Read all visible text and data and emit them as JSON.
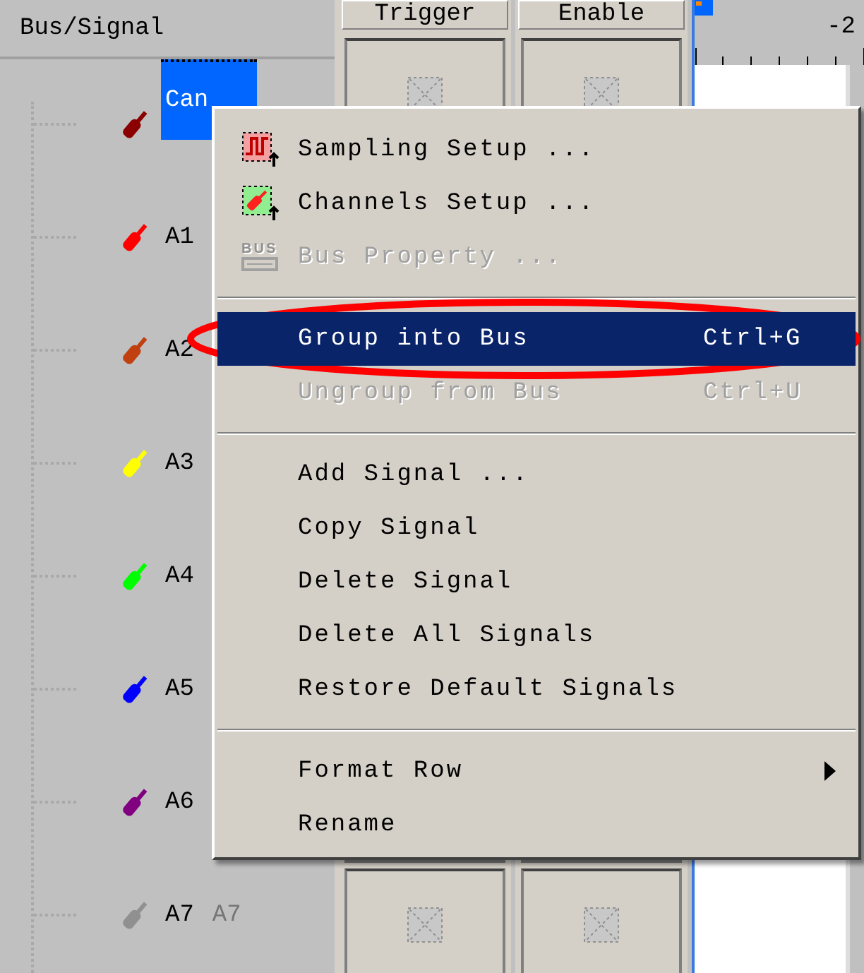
{
  "signal_panel": {
    "header": "Bus/Signal",
    "signals": [
      {
        "name": "Can",
        "color": "#8b0000",
        "selected": true
      },
      {
        "name": "A1",
        "color": "#ff0000",
        "selected": false
      },
      {
        "name": "A2",
        "color": "#c04010",
        "selected": false
      },
      {
        "name": "A3",
        "color": "#ffff00",
        "selected": false
      },
      {
        "name": "A4",
        "color": "#00ff00",
        "selected": false
      },
      {
        "name": "A5",
        "color": "#0000ff",
        "selected": false
      },
      {
        "name": "A6",
        "color": "#800080",
        "selected": false
      },
      {
        "name": "A7",
        "color": "#909090",
        "selected": false,
        "alias": "A7"
      }
    ]
  },
  "columns": [
    {
      "header": "Trigger"
    },
    {
      "header": "Enable"
    }
  ],
  "timeline": {
    "tick_label": "-2"
  },
  "context_menu": {
    "items": [
      {
        "kind": "item",
        "label": "Sampling Setup ...",
        "disabled": false,
        "selected": false
      },
      {
        "kind": "item",
        "label": "Channels Setup ...",
        "disabled": false,
        "selected": false
      },
      {
        "kind": "item",
        "icon_text": "BUS",
        "label": "Bus Property ...",
        "disabled": true,
        "selected": false
      },
      {
        "kind": "separator"
      },
      {
        "kind": "item",
        "label": "Group into Bus",
        "shortcut": "Ctrl+G",
        "disabled": false,
        "selected": true,
        "circled": true
      },
      {
        "kind": "item",
        "label": "Ungroup from Bus",
        "shortcut": "Ctrl+U",
        "disabled": true,
        "selected": false
      },
      {
        "kind": "separator"
      },
      {
        "kind": "item",
        "label": "Add Signal ...",
        "disabled": false,
        "selected": false
      },
      {
        "kind": "item",
        "label": "Copy Signal",
        "disabled": false,
        "selected": false
      },
      {
        "kind": "item",
        "label": "Delete Signal",
        "disabled": false,
        "selected": false
      },
      {
        "kind": "item",
        "label": "Delete All Signals",
        "disabled": false,
        "selected": false
      },
      {
        "kind": "item",
        "label": "Restore Default Signals",
        "disabled": false,
        "selected": false
      },
      {
        "kind": "separator"
      },
      {
        "kind": "item",
        "label": "Format Row",
        "disabled": false,
        "selected": false,
        "submenu": true
      },
      {
        "kind": "item",
        "label": "Rename",
        "disabled": false,
        "selected": false
      }
    ]
  }
}
